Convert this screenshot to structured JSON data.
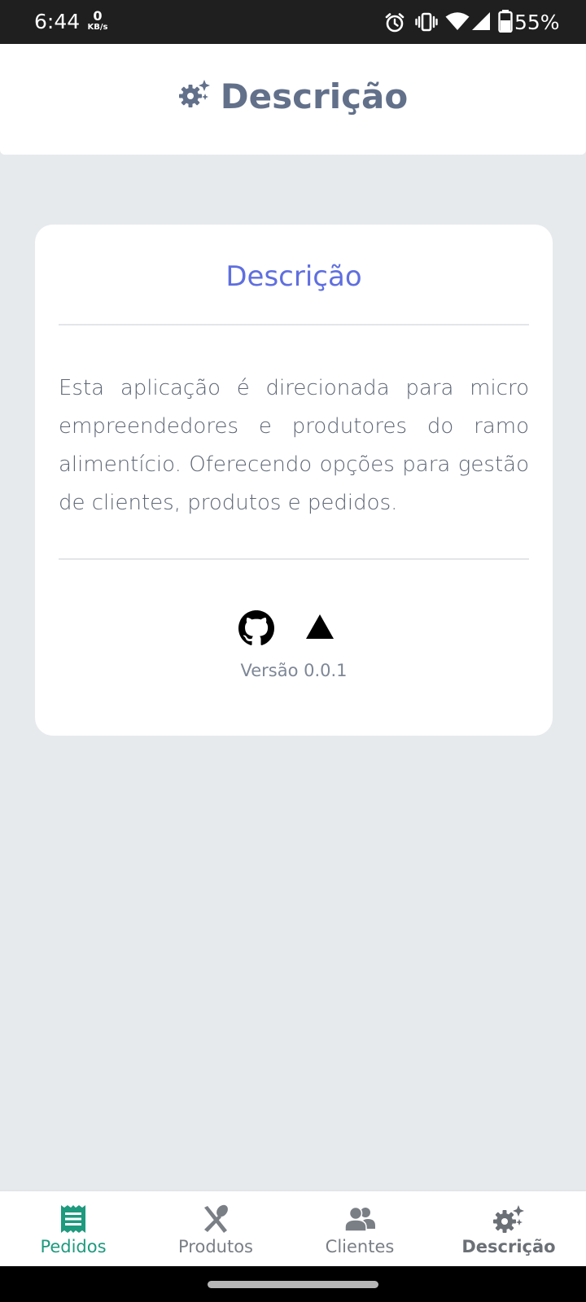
{
  "status_bar": {
    "time": "6:44",
    "net_speed_value": "0",
    "net_speed_unit": "KB/s",
    "battery_percent": "55%",
    "icons": [
      "alarm-icon",
      "vibrate-icon",
      "wifi-icon",
      "cell-signal-icon",
      "battery-icon"
    ]
  },
  "header": {
    "title": "Descrição",
    "icon": "gears-icon"
  },
  "card": {
    "title": "Descrição",
    "description": "Esta aplicação é direcionada para micro empreendedores e produtores do ramo alimentício. Oferecendo opções para gestão de clientes, produtos e pedidos.",
    "links": [
      "github-icon",
      "vercel-icon"
    ],
    "version": "Versão 0.0.1"
  },
  "bottom_nav": {
    "items": [
      {
        "label": "Pedidos",
        "icon": "receipt-icon",
        "active": true
      },
      {
        "label": "Produtos",
        "icon": "utensils-icon",
        "active": false
      },
      {
        "label": "Clientes",
        "icon": "users-icon",
        "active": false
      },
      {
        "label": "Descrição",
        "icon": "gears-icon",
        "active": false
      }
    ]
  },
  "colors": {
    "background": "#e7eaed",
    "header_title": "#62708a",
    "card_title": "#5f6fe0",
    "nav_active": "#1e9a7e",
    "nav_inactive": "#7a7f86"
  }
}
